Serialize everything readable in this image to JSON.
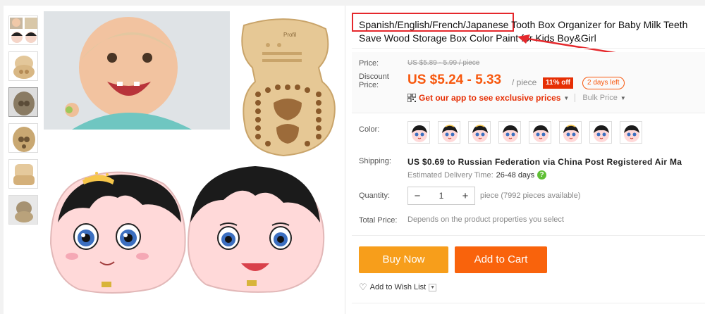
{
  "product": {
    "title": "Spanish/English/French/Japanese Tooth Box Organizer for Baby Milk Teeth Save Wood Storage Box Color Paint for Kids Boy&Girl"
  },
  "price": {
    "label": "Price:",
    "original": "US $5.89 - 5.99 / piece",
    "discount_label_1": "Discount",
    "discount_label_2": "Price:",
    "sale": "US $5.24 - 5.33",
    "unit": "/ piece",
    "off_badge": "11% off",
    "days_left": "2 days left",
    "app_promo": "Get our app to see exclusive prices",
    "bulk": "Bulk Price"
  },
  "color": {
    "label": "Color:",
    "swatch_count": 8
  },
  "shipping": {
    "label": "Shipping:",
    "cost": "US $0.69",
    "to_text": "to Russian Federation via China Post Registered Air Ma",
    "delivery_label": "Estimated Delivery Time:",
    "delivery_days": "26-48 days",
    "help": "?"
  },
  "quantity": {
    "label": "Quantity:",
    "minus": "−",
    "value": "1",
    "plus": "+",
    "available": "piece (7992 pieces available)"
  },
  "total": {
    "label": "Total Price:",
    "note": "Depends on the product properties you select"
  },
  "actions": {
    "buy_now": "Buy Now",
    "add_to_cart": "Add to Cart",
    "wishlist": "Add to Wish List"
  },
  "colors": {
    "accent_orange": "#f7580e",
    "buy_now_bg": "#f79e1b",
    "cart_bg": "#f9630c",
    "highlight_red": "#e5282c"
  }
}
